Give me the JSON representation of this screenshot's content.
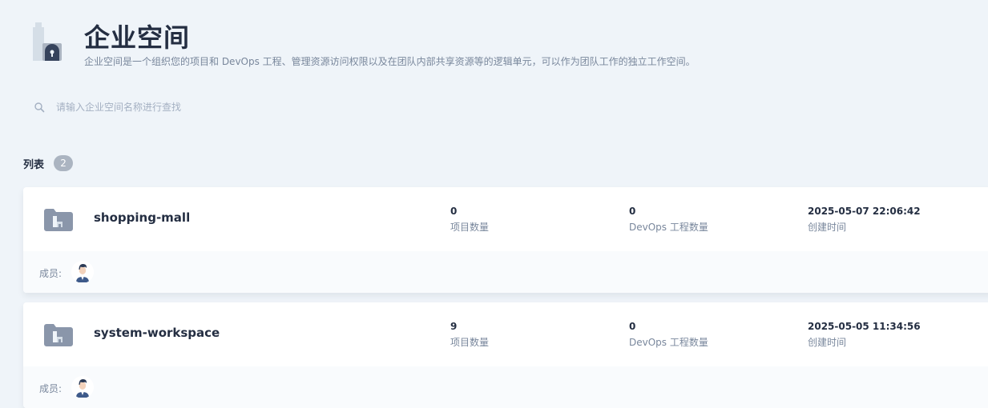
{
  "header": {
    "title": "企业空间",
    "description": "企业空间是一个组织您的项目和 DevOps 工程、管理资源访问权限以及在团队内部共享资源等的逻辑单元，可以作为团队工作的独立工作空间。",
    "icon": "workspace-building-icon"
  },
  "search": {
    "placeholder": "请输入企业空间名称进行查找",
    "value": "",
    "icon": "search-icon"
  },
  "list": {
    "title": "列表",
    "count": "2"
  },
  "colors": {
    "background": "#eff4f9",
    "text_primary": "#242e42",
    "text_secondary": "#79879c",
    "badge": "#abb4c1",
    "icon_fill": "#8a96aa"
  },
  "workspaces": [
    {
      "name": "shopping-mall",
      "projects_count": "0",
      "projects_label": "项目数量",
      "devops_count": "0",
      "devops_label": "DevOps 工程数量",
      "created_time": "2025-05-07 22:06:42",
      "created_label": "创建时间",
      "members_label": "成员:"
    },
    {
      "name": "system-workspace",
      "projects_count": "9",
      "projects_label": "项目数量",
      "devops_count": "0",
      "devops_label": "DevOps 工程数量",
      "created_time": "2025-05-05 11:34:56",
      "created_label": "创建时间",
      "members_label": "成员:"
    }
  ]
}
